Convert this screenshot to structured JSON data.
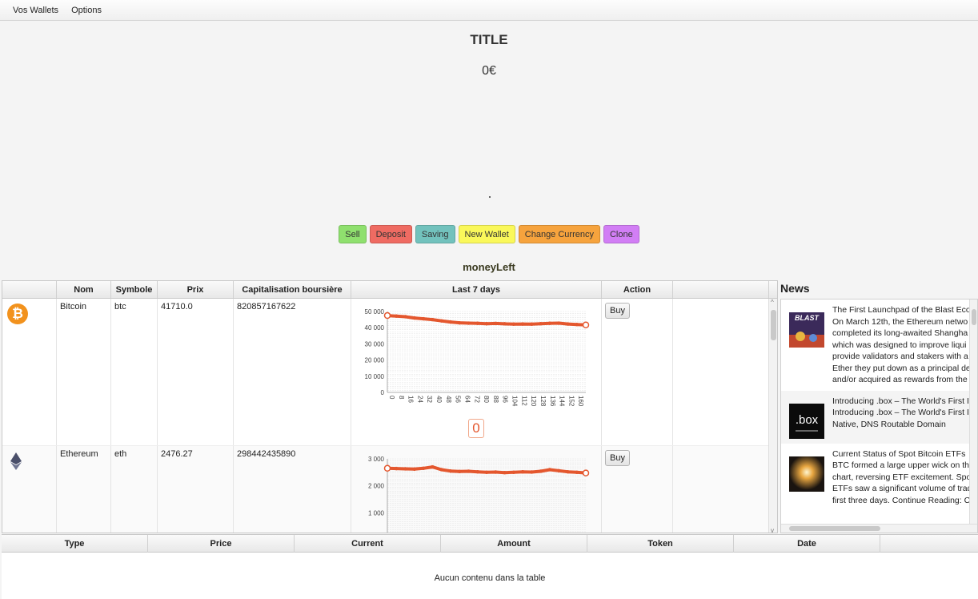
{
  "menu": {
    "items": [
      "Vos Wallets",
      "Options"
    ]
  },
  "title": "TITLE",
  "balance": "0€",
  "buttons": {
    "sell": "Sell",
    "deposit": "Deposit",
    "saving": "Saving",
    "new_wallet": "New Wallet",
    "change_currency": "Change Currency",
    "clone": "Clone"
  },
  "money_left": "moneyLeft",
  "crypto_table": {
    "headers": [
      "",
      "Nom",
      "Symbole",
      "Prix",
      "Capitalisation boursière",
      "Last 7 days",
      "Action",
      ""
    ],
    "rows": [
      {
        "icon": "bitcoin-icon",
        "name": "Bitcoin",
        "symbol": "btc",
        "price": "41710.0",
        "market_cap": "820857167622",
        "action": "Buy",
        "badge": "0"
      },
      {
        "icon": "ethereum-icon",
        "name": "Ethereum",
        "symbol": "eth",
        "price": "2476.27",
        "market_cap": "298442435890",
        "action": "Buy"
      }
    ]
  },
  "chart_data": [
    {
      "type": "line",
      "title": "",
      "xlabel": "",
      "ylabel": "",
      "ylim": [
        0,
        50000
      ],
      "yticks": [
        "50 000",
        "40 000",
        "30 000",
        "20 000",
        "10 000",
        "0"
      ],
      "xticks": [
        "0",
        "8",
        "16",
        "24",
        "32",
        "40",
        "48",
        "56",
        "64",
        "72",
        "80",
        "88",
        "96",
        "104",
        "112",
        "120",
        "128",
        "136",
        "144",
        "152",
        "160"
      ],
      "xlim": [
        0,
        168
      ],
      "series": [
        {
          "values": [
            47500,
            47200,
            46800,
            46000,
            45500,
            45000,
            44200,
            43500,
            43000,
            42800,
            42700,
            42500,
            42600,
            42400,
            42200,
            42300,
            42200,
            42500,
            42700,
            42800,
            42300,
            42000,
            41710
          ]
        }
      ],
      "color": "#e4572e"
    },
    {
      "type": "line",
      "title": "",
      "xlabel": "",
      "ylabel": "",
      "ylim": [
        0,
        3000
      ],
      "yticks": [
        "3 000",
        "2 000",
        "1 000"
      ],
      "xlim": [
        0,
        168
      ],
      "series": [
        {
          "values": [
            2650,
            2640,
            2630,
            2620,
            2650,
            2700,
            2600,
            2550,
            2530,
            2540,
            2520,
            2500,
            2510,
            2490,
            2500,
            2520,
            2510,
            2540,
            2600,
            2560,
            2520,
            2500,
            2476
          ]
        }
      ],
      "color": "#e4572e"
    }
  ],
  "news": {
    "title": "News",
    "items": [
      {
        "image": "blast-logo-image",
        "image_text": "BLAST",
        "lines": [
          "The First Launchpad of the Blast Ecos",
          "On March 12th, the Ethereum netwo",
          "completed its long-awaited Shangha",
          "which was designed to improve liqui",
          "provide validators and stakers with a",
          "Ether they put down as a principal de",
          "and/or acquired as rewards from the"
        ]
      },
      {
        "image": "box-logo-image",
        "image_text": ".box",
        "lines": [
          "Introducing .box – The World's First I",
          "Introducing .box – The World's First I",
          "Native, DNS Routable Domain"
        ]
      },
      {
        "image": "bitcoin-etf-image",
        "lines": [
          "Current Status of Spot Bitcoin ETFs",
          "BTC formed a large upper wick on th",
          "chart, reversing ETF excitement. Spot",
          "ETFs saw a significant volume of trad",
          "first three days. Continue Reading: C"
        ]
      }
    ]
  },
  "transactions": {
    "headers": [
      "Type",
      "Price",
      "Current",
      "Amount",
      "Token",
      "Date"
    ],
    "empty_text": "Aucun contenu dans la table"
  }
}
